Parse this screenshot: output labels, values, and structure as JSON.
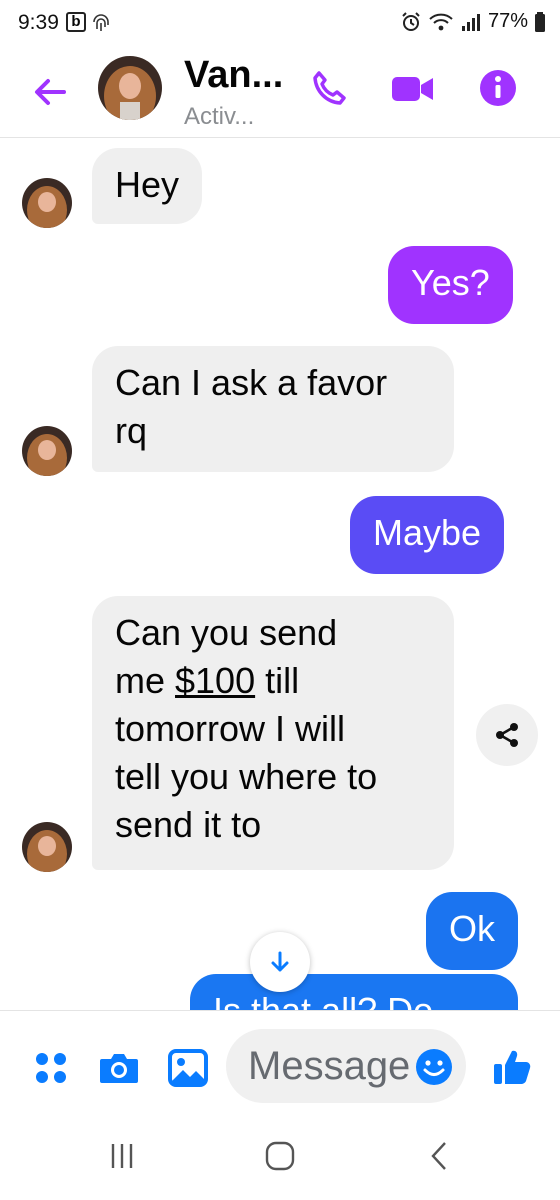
{
  "status_bar": {
    "time": "9:39",
    "b_badge": "b",
    "battery": "77%"
  },
  "header": {
    "contact_name": "Van...",
    "contact_status": "Activ..."
  },
  "messages": [
    {
      "direction": "incoming",
      "text": "Hey"
    },
    {
      "direction": "outgoing",
      "text": "Yes?",
      "color": "#a033ff"
    },
    {
      "direction": "incoming",
      "lines": [
        "Can I ask a favor",
        "rq"
      ]
    },
    {
      "direction": "outgoing",
      "text": "Maybe",
      "color": "#5a4cf5"
    },
    {
      "direction": "incoming",
      "lines": [
        "Can you send",
        "me ",
        "$100",
        " till",
        "tomorrow I will",
        "tell you where to",
        "send it to"
      ]
    },
    {
      "direction": "outgoing",
      "text": "Ok",
      "color": "#1b74f0"
    },
    {
      "direction": "outgoing",
      "text": "Is that all? Do...",
      "color": "#1a77f2"
    }
  ],
  "composer": {
    "placeholder": "Message"
  },
  "colors": {
    "accent_purple": "#a033ff",
    "messenger_blue": "#0a7cff",
    "incoming_bubble": "#efefef"
  },
  "icons": {
    "back": "back-arrow-icon",
    "call": "phone-icon",
    "video": "video-camera-icon",
    "info": "info-icon",
    "share": "share-icon",
    "scroll": "arrow-down-icon",
    "apps": "four-dots-icon",
    "camera": "camera-icon",
    "gallery": "image-icon",
    "emoji": "smiley-icon",
    "like": "thumbs-up-icon"
  }
}
